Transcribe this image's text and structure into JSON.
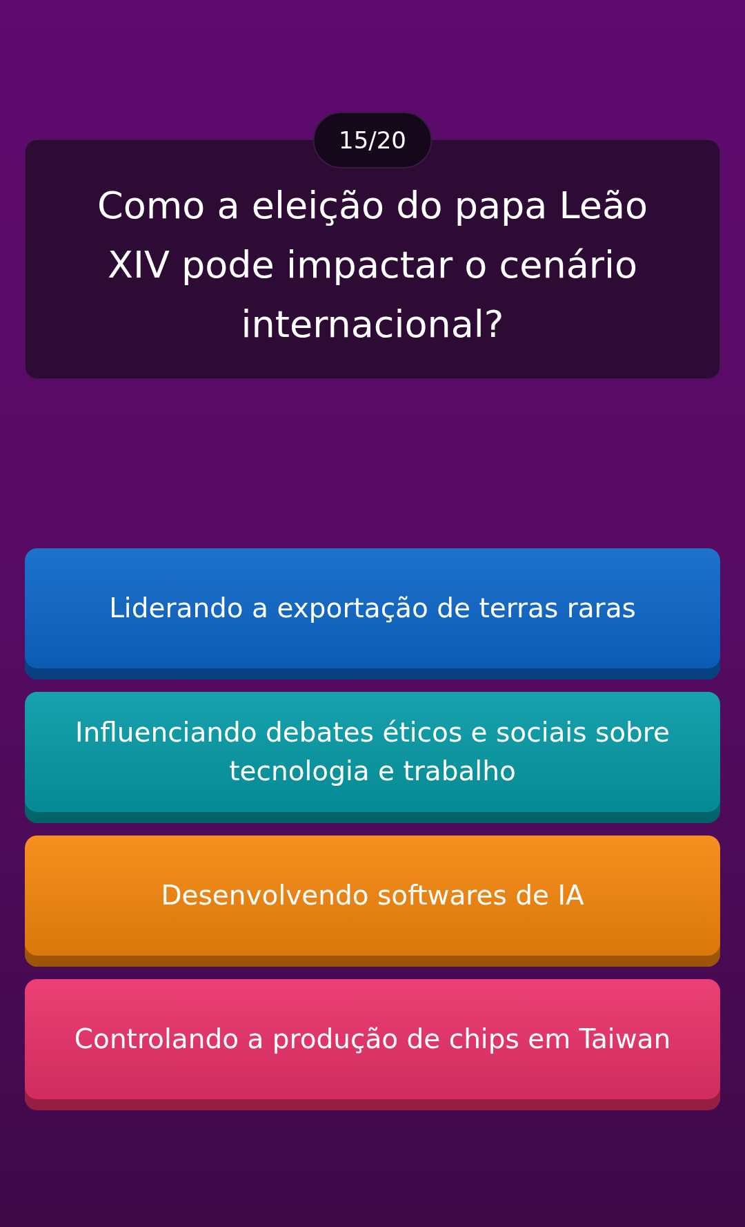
{
  "counter": "15/20",
  "question": "Como a eleição do papa Leão XIV pode impactar o cenário internacional?",
  "answers": [
    {
      "text": "Liderando a exportação de terras raras",
      "color": "#0b66c8"
    },
    {
      "text": "Influenciando debates éticos e sociais sobre tecnologia e trabalho",
      "color": "#049aa6"
    },
    {
      "text": "Desenvolvendo softwares de IA",
      "color": "#f5860c"
    },
    {
      "text": "Controlando a produção de chips em Taiwan",
      "color": "#ea3069"
    }
  ]
}
